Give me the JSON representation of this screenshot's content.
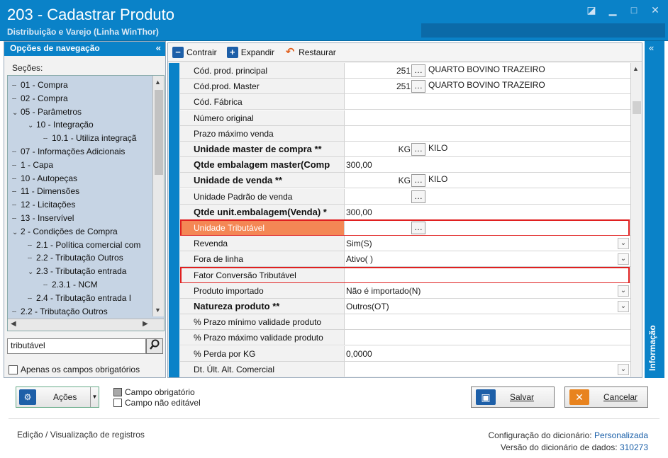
{
  "window": {
    "title": "203 - Cadastrar  Produto",
    "subtitle": "Distribuição e Varejo (Linha WinThor)",
    "controls": [
      "restore",
      "minimize",
      "maximize",
      "close"
    ]
  },
  "nav": {
    "header": "Opções de navegação",
    "collapse_icon": "«",
    "sections_label": "Seções:",
    "tree": [
      {
        "label": "01 - Compra",
        "level": 0,
        "toggle": ""
      },
      {
        "label": "02 - Compra",
        "level": 0,
        "toggle": ""
      },
      {
        "label": "05 - Parâmetros",
        "level": 0,
        "toggle": "v"
      },
      {
        "label": "10 - Integração",
        "level": 1,
        "toggle": "v"
      },
      {
        "label": "10.1 - Utiliza integraçã",
        "level": 2,
        "toggle": ""
      },
      {
        "label": "07 - Informações Adicionais",
        "level": 0,
        "toggle": ""
      },
      {
        "label": "1 - Capa",
        "level": 0,
        "toggle": ""
      },
      {
        "label": "10 - Autopeças",
        "level": 0,
        "toggle": ""
      },
      {
        "label": "11 - Dimensões",
        "level": 0,
        "toggle": ""
      },
      {
        "label": "12 - Licitações",
        "level": 0,
        "toggle": ""
      },
      {
        "label": "13 - Inservível",
        "level": 0,
        "toggle": ""
      },
      {
        "label": "2 - Condições de Compra",
        "level": 0,
        "toggle": "v"
      },
      {
        "label": "2.1 - Política comercial com",
        "level": 1,
        "toggle": ""
      },
      {
        "label": "2.2 - Tributação Outros",
        "level": 1,
        "toggle": ""
      },
      {
        "label": "2.3 - Tributação entrada",
        "level": 1,
        "toggle": "v"
      },
      {
        "label": "2.3.1 - NCM",
        "level": 2,
        "toggle": ""
      },
      {
        "label": "2.4 - Tributação entrada I",
        "level": 1,
        "toggle": ""
      },
      {
        "label": "2.2 - Tributação Outros",
        "level": 0,
        "toggle": ""
      }
    ],
    "search_value": "tributável",
    "only_required_label": "Apenas os campos obrigatórios"
  },
  "toolbar": {
    "collapse": "Contrair",
    "expand": "Expandir",
    "restore": "Restaurar"
  },
  "grid": {
    "rows": [
      {
        "label": "Cód. prod. principal",
        "bold": false,
        "num": "251",
        "dots": true,
        "desc": "QUARTO BOVINO TRAZEIRO",
        "text": "",
        "dropdown": false
      },
      {
        "label": "Cód.prod. Master",
        "bold": false,
        "num": "251",
        "dots": true,
        "desc": "QUARTO BOVINO TRAZEIRO",
        "text": "",
        "dropdown": false
      },
      {
        "label": "Cód. Fábrica",
        "bold": false,
        "num": "",
        "dots": false,
        "desc": "",
        "text": "",
        "dropdown": false
      },
      {
        "label": "Número original",
        "bold": false,
        "num": "",
        "dots": false,
        "desc": "",
        "text": "",
        "dropdown": false
      },
      {
        "label": "Prazo máximo venda",
        "bold": false,
        "num": "",
        "dots": false,
        "desc": "",
        "text": "",
        "dropdown": false
      },
      {
        "label": "Unidade master de compra **",
        "bold": true,
        "num": "KG",
        "dots": true,
        "desc": "KILO",
        "text": "",
        "dropdown": false
      },
      {
        "label": "Qtde embalagem master(Comp",
        "bold": true,
        "num": "",
        "dots": false,
        "desc": "",
        "text": "300,00",
        "dropdown": false
      },
      {
        "label": "Unidade de venda **",
        "bold": true,
        "num": "KG",
        "dots": true,
        "desc": "KILO",
        "text": "",
        "dropdown": false
      },
      {
        "label": "Unidade Padrão de venda",
        "bold": false,
        "num": "",
        "dots": true,
        "desc": "",
        "text": "",
        "dropdown": false
      },
      {
        "label": "Qtde unit.embalagem(Venda) *",
        "bold": true,
        "num": "",
        "dots": false,
        "desc": "",
        "text": "300,00",
        "dropdown": false
      },
      {
        "label": "Unidade Tributável",
        "bold": false,
        "num": "",
        "dots": true,
        "desc": "",
        "text": "",
        "dropdown": false,
        "highlight": true,
        "outline": true
      },
      {
        "label": "Revenda",
        "bold": false,
        "num": "",
        "dots": false,
        "desc": "",
        "text": "Sim(S)",
        "dropdown": true
      },
      {
        "label": "Fora de linha",
        "bold": false,
        "num": "",
        "dots": false,
        "desc": "",
        "text": "Ativo(  )",
        "dropdown": true
      },
      {
        "label": "Fator Conversão Tributável",
        "bold": false,
        "num": "",
        "dots": false,
        "desc": "",
        "text": "",
        "dropdown": false,
        "outline": true
      },
      {
        "label": "Produto importado",
        "bold": false,
        "num": "",
        "dots": false,
        "desc": "",
        "text": "Não é importado(N)",
        "dropdown": true
      },
      {
        "label": "Natureza produto **",
        "bold": true,
        "num": "",
        "dots": false,
        "desc": "",
        "text": "Outros(OT)",
        "dropdown": true
      },
      {
        "label": "% Prazo mínimo validade produto",
        "bold": false,
        "num": "",
        "dots": false,
        "desc": "",
        "text": "",
        "dropdown": false
      },
      {
        "label": "% Prazo máximo validade produto",
        "bold": false,
        "num": "",
        "dots": false,
        "desc": "",
        "text": "",
        "dropdown": false
      },
      {
        "label": "% Perda por KG",
        "bold": false,
        "num": "",
        "dots": false,
        "desc": "",
        "text": "0,0000",
        "dropdown": false
      },
      {
        "label": "Dt. Últ. Alt. Comercial",
        "bold": false,
        "num": "",
        "dots": false,
        "desc": "",
        "text": "",
        "dropdown": true
      }
    ]
  },
  "info_tab": {
    "label": "Informação",
    "collapse_icon": "«"
  },
  "bottom": {
    "acoes_label": "Ações",
    "legend_required": "Campo obrigatório",
    "legend_not_editable": "Campo não editável",
    "save_label": "Salvar",
    "cancel_label": "Cancelar",
    "status_left": "Edição / Visualização de registros",
    "dict_config_label": "Configuração do dicionário:",
    "dict_config_value": "Personalizada",
    "dict_version_label": "Versão do dicionário de dados:",
    "dict_version_value": "310273"
  },
  "colors": {
    "titlebar": "#0a82c8",
    "highlight_row": "#f48755",
    "outline_red": "#e02020",
    "tree_bg": "#c6d4e4"
  }
}
